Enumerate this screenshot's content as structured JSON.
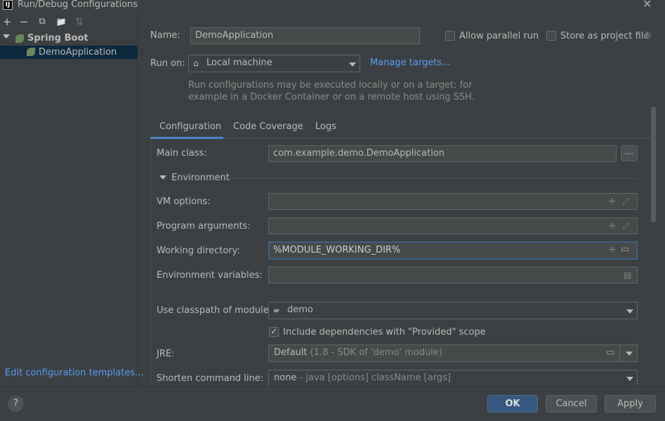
{
  "window": {
    "title": "Run/Debug Configurations",
    "logo_text": "IJ",
    "close_glyph": "✕"
  },
  "left_panel": {
    "toolbar": {
      "add_glyph": "+",
      "remove_glyph": "−",
      "copy_glyph": "⧉",
      "folder_glyph": "📁",
      "sort_glyph": "⇅"
    },
    "tree": {
      "root_label": "Spring Boot",
      "child_label": "DemoApplication"
    },
    "edit_templates_link": "Edit configuration templates..."
  },
  "main": {
    "name_label": "Name:",
    "name_value": "DemoApplication",
    "allow_parallel_label": "Allow parallel run",
    "allow_parallel_checked": false,
    "store_project_file_label": "Store as project file",
    "store_project_file_checked": false,
    "run_on_label": "Run on:",
    "run_on_value": "Local machine",
    "manage_targets_link": "Manage targets...",
    "run_on_hint_line1": "Run configurations may be executed locally or on a target: for",
    "run_on_hint_line2": "example in a Docker Container or on a remote host using SSH.",
    "tabs": [
      {
        "label": "Configuration",
        "active": true
      },
      {
        "label": "Code Coverage",
        "active": false
      },
      {
        "label": "Logs",
        "active": false
      }
    ],
    "main_class_label": "Main class:",
    "main_class_value": "com.example.demo.DemoApplication",
    "browse_button_label": "...",
    "environment_section_label": "Environment",
    "vm_options_label": "VM options:",
    "vm_options_value": "",
    "program_args_label": "Program arguments:",
    "program_args_value": "",
    "working_dir_label": "Working directory:",
    "working_dir_value": "%MODULE_WORKING_DIR%",
    "env_vars_label": "Environment variables:",
    "env_vars_value": "",
    "classpath_label": "Use classpath of module:",
    "classpath_value": "demo",
    "include_deps_label": "Include dependencies with \"Provided\" scope",
    "include_deps_checked": true,
    "jre_label": "JRE:",
    "jre_value": "Default",
    "jre_hint": "(1.8 - SDK of 'demo' module)",
    "shorten_label": "Shorten command line:",
    "shorten_value": "none",
    "shorten_hint": "- java [options] className [args]"
  },
  "footer": {
    "help_glyph": "?",
    "ok_label": "OK",
    "cancel_label": "Cancel",
    "apply_label": "Apply"
  },
  "colors": {
    "background": "#3c3f41",
    "field_background": "#45494a",
    "accent_link": "#589df6",
    "tab_active": "#4a88c7",
    "selection": "#0d293e",
    "primary_button": "#365880"
  }
}
